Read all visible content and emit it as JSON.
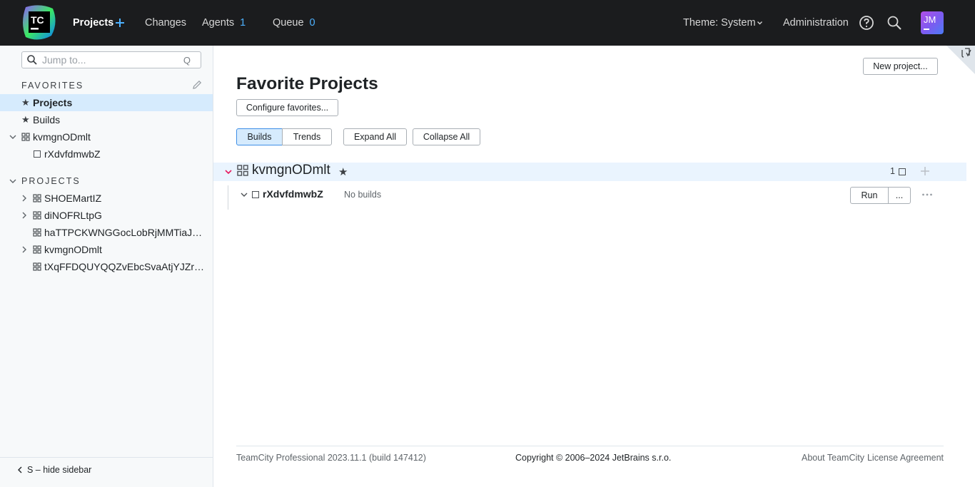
{
  "topbar": {
    "logo_text": "TC",
    "nav": {
      "projects": "Projects",
      "changes": "Changes",
      "agents": "Agents",
      "agents_count": "1",
      "queue": "Queue",
      "queue_count": "0",
      "theme": "Theme: System",
      "administration": "Administration"
    },
    "avatar_initials": "JM"
  },
  "sidebar": {
    "search_placeholder": "Jump to...",
    "search_shortcut": "Q",
    "favorites_label": "FAVORITES",
    "favorites": [
      {
        "label": "Projects"
      },
      {
        "label": "Builds"
      },
      {
        "label": "kvmgnODmlt"
      },
      {
        "label": "rXdvfdmwbZ"
      }
    ],
    "projects_label": "PROJECTS",
    "projects": [
      {
        "label": "SHOEMartIZ"
      },
      {
        "label": "diNOFRLtpG"
      },
      {
        "label": "haTTPCKWNGGocLobRjMMTiaJ…"
      },
      {
        "label": "kvmgnODmlt"
      },
      {
        "label": "tXqFFDQUYQQZvEbcSvaAtjYJZr…"
      }
    ],
    "hide_sidebar": "S – hide sidebar"
  },
  "main": {
    "new_project": "New project...",
    "title": "Favorite Projects",
    "configure_favorites": "Configure favorites...",
    "tabs": {
      "builds": "Builds",
      "trends": "Trends"
    },
    "expand_all": "Expand All",
    "collapse_all": "Collapse All",
    "project": {
      "name": "kvmgnODmlt",
      "count": "1",
      "build_config": {
        "name": "rXdvfdmwbZ",
        "status": "No builds",
        "run": "Run",
        "run_options": "..."
      }
    }
  },
  "footer": {
    "version": "TeamCity Professional 2023.11.1 (build 147412)",
    "copyright": "Copyright © 2006–2024 JetBrains s.r.o.",
    "about": "About TeamCity",
    "license": "License Agreement"
  },
  "colors": {
    "topbar_bg": "#1b1c1e",
    "accent_blue": "#4db1ff",
    "selected_row": "#d6ebfd",
    "project_row": "#eaf4fe",
    "chevron_red": "#e8175d"
  }
}
